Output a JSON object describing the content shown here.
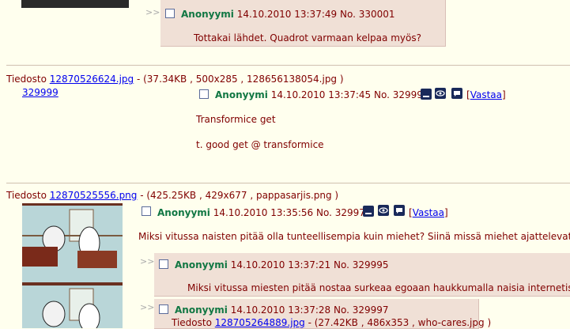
{
  "top_reply": {
    "name": "Anonyymi",
    "date": "14.10.2010 13:37:49",
    "no": "No. 330001",
    "message": "Tottakai lähdet. Quadrot varmaan kelpaa myös?"
  },
  "thread1": {
    "file_prefix": "Tiedosto",
    "file_link": "12870526624.jpg",
    "file_info": "- (37.34KB , 500x285 , 128656138054.jpg )",
    "thumb_link": "329999",
    "name": "Anonyymi",
    "date": "14.10.2010 13:37:45",
    "no": "No. 329999",
    "reply_link": "Vastaa",
    "message_line1": "Transformice get",
    "message_line2": "t. good get @ transformice"
  },
  "thread2": {
    "file_prefix": "Tiedosto",
    "file_link": "12870525556.png",
    "file_info": "- (425.25KB , 429x677 , pappasarjis.png )",
    "name": "Anonyymi",
    "date": "14.10.2010 13:35:56",
    "no": "No. 329979",
    "reply_link": "Vastaa",
    "message": "Miksi vitussa naisten pitää olla tunteellisempia kuin miehet? Siinä missä miehet ajattelevat järj",
    "replies": [
      {
        "name": "Anonyymi",
        "date": "14.10.2010 13:37:21",
        "no": "No. 329995",
        "message": "Miksi vitussa miesten pitää nostaa surkeaa egoaan haukkumalla naisia internetissä?"
      },
      {
        "name": "Anonyymi",
        "date": "14.10.2010 13:37:28",
        "no": "No. 329997",
        "file_prefix": "Tiedosto",
        "file_link": "128705264889.jpg",
        "file_info": "- (27.42KB , 486x353 , who-cares.jpg )"
      }
    ]
  },
  "arrows": ">>",
  "colors": {
    "background": "#ffffee",
    "reply_bg": "#f0e0d6",
    "name": "#117743",
    "link": "#0000ee",
    "text": "#800000"
  }
}
